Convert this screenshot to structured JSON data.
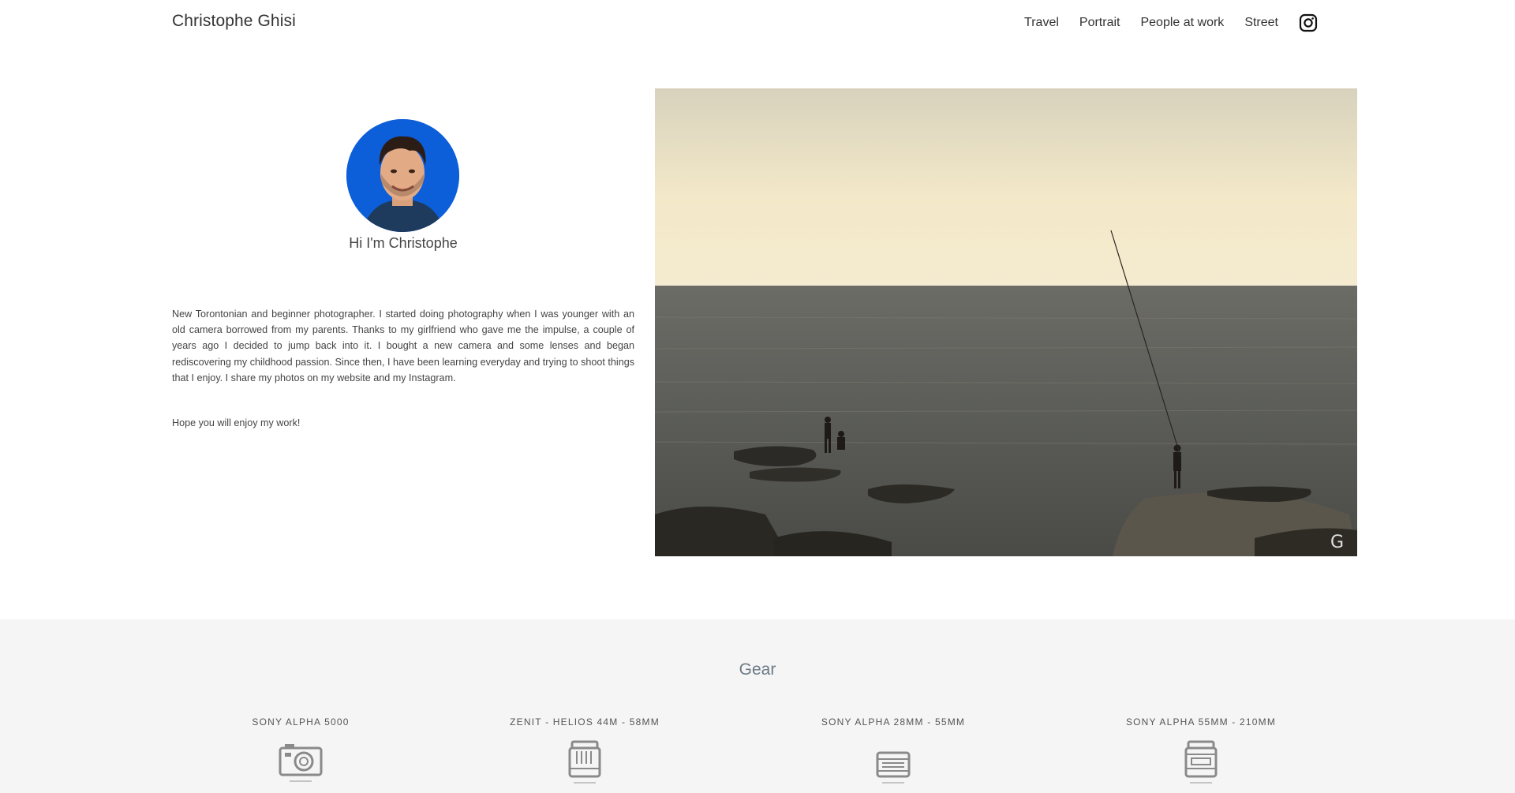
{
  "header": {
    "brand": "Christophe Ghisi",
    "nav": [
      {
        "label": "Travel"
      },
      {
        "label": "Portrait"
      },
      {
        "label": "People at work"
      },
      {
        "label": "Street"
      }
    ],
    "social_icon": "instagram-icon"
  },
  "intro": {
    "greeting": "Hi I'm Christophe",
    "bio": "New Torontonian and beginner photographer. I started doing photography when I was younger with an old camera borrowed from my parents. Thanks to my girlfriend who gave me the impulse, a couple of years ago I decided to jump back into it. I bought a new camera and some lenses and began rediscovering my childhood passion. Since then, I have been learning everyday and trying to shoot things that I enjoy. I share my photos on my website and my Instagram.",
    "closing": "Hope you will enjoy my work!",
    "avatar_bg": "#0c5ed9"
  },
  "gear": {
    "title": "Gear",
    "items": [
      {
        "name": "SONY ALPHA 5000",
        "icon": "camera-icon"
      },
      {
        "name": "ZENIT - HELIOS 44M - 58MM",
        "icon": "lens-icon"
      },
      {
        "name": "SONY ALPHA 28MM - 55MM",
        "icon": "lens-icon"
      },
      {
        "name": "SONY ALPHA 55MM - 210MM",
        "icon": "lens-icon"
      }
    ]
  }
}
